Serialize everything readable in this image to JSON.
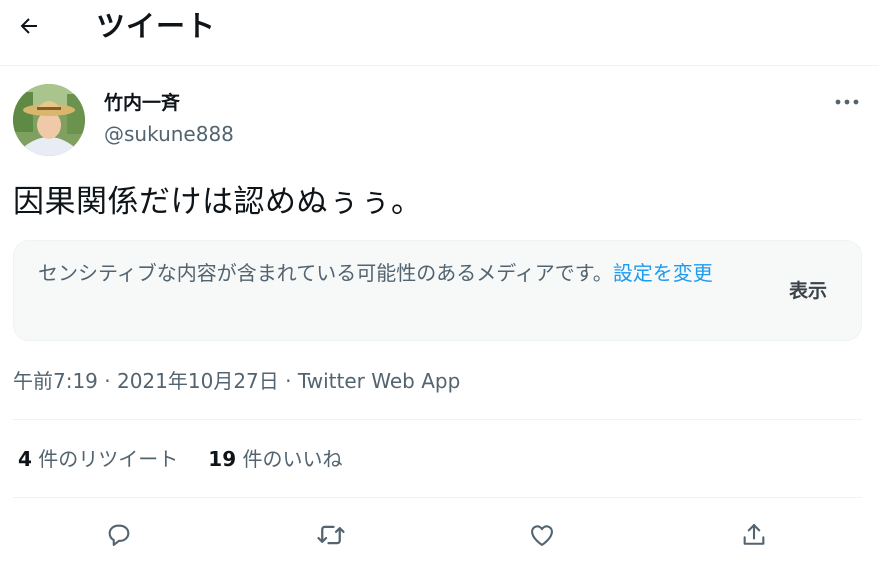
{
  "header": {
    "title": "ツイート",
    "back_icon": "arrow-left-icon"
  },
  "tweet": {
    "author": {
      "name": "竹内一斉",
      "handle": "@sukune888"
    },
    "text": "因果関係だけは認めぬぅぅ。",
    "sensitive": {
      "message": "センシティブな内容が含まれている可能性のあるメディアです。",
      "settings_link": "設定を変更",
      "show_button": "表示"
    },
    "meta": "午前7:19 · 2021年10月27日 · Twitter Web App",
    "stats": {
      "retweets_count": "4",
      "retweets_label": "件のリツイート",
      "likes_count": "19",
      "likes_label": "件のいいね"
    },
    "actions": [
      "reply-icon",
      "retweet-icon",
      "like-icon",
      "share-icon"
    ]
  },
  "colors": {
    "accent": "#1d9bf0",
    "text": "#0f1419",
    "secondary": "#536471",
    "border": "#eff3f4"
  }
}
